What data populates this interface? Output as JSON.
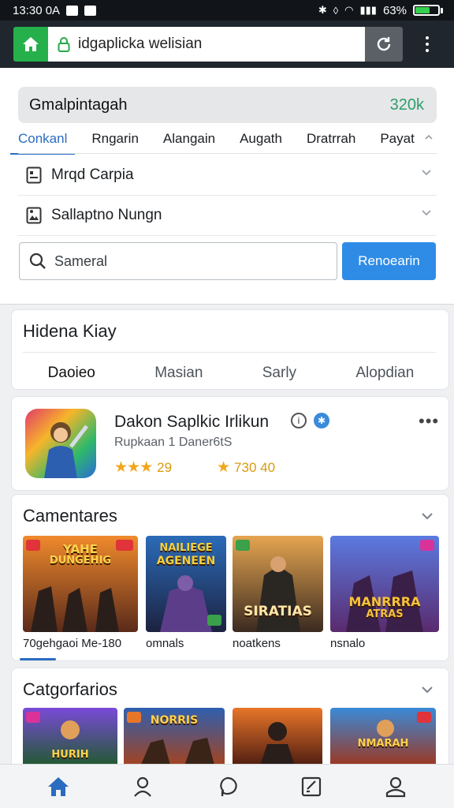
{
  "status_bar": {
    "time": "13:30 0A",
    "battery_percent": "63%",
    "battery_level": 0.63
  },
  "browser": {
    "url": "idgaplicka welisian",
    "home_icon": "home-icon",
    "lock_icon": "lock-icon",
    "reload_icon": "reload-icon",
    "menu_icon": "kebab-menu-icon"
  },
  "search_panel": {
    "title": "Gmalpintagah",
    "count": "320k",
    "tabs": [
      {
        "label": "Conkanl",
        "active": true
      },
      {
        "label": "Rngarin",
        "active": false
      },
      {
        "label": "Alangain",
        "active": false
      },
      {
        "label": "Augath",
        "active": false
      },
      {
        "label": "Dratrrah",
        "active": false
      },
      {
        "label": "Payat",
        "active": false
      }
    ],
    "filters": [
      {
        "label": "Mrqd Carpia",
        "icon": "doc-icon"
      },
      {
        "label": "Sallaptno Nungn",
        "icon": "image-icon"
      }
    ],
    "search_placeholder": "Sameral",
    "search_button": "Renoearin"
  },
  "hidden_key_card": {
    "title": "Hidena Kiay",
    "tabs": [
      {
        "label": "Daoieo",
        "active": true
      },
      {
        "label": "Masian",
        "active": false
      },
      {
        "label": "Sarly",
        "active": false
      },
      {
        "label": "Alopdian",
        "active": false
      }
    ]
  },
  "app_card": {
    "name": "Dakon Saplkic Irlikun",
    "subtitle": "Rupkaan 1 Daner6tS",
    "rating_a": "29",
    "rating_a_stars": 3,
    "rating_b": "730 40"
  },
  "comments_section": {
    "title": "Camentares",
    "thumbs": [
      {
        "art_title": "YAHE",
        "art_sub": "DUNGEHIG",
        "caption": "70gehgaoi Me-180",
        "colors": [
          "#f08a2c",
          "#5a2a1a"
        ]
      },
      {
        "art_title": "NAILIEGE",
        "art_sub": "AGENEEN",
        "caption": "omnals",
        "colors": [
          "#2b6bb8",
          "#1c2240"
        ]
      },
      {
        "art_title": "SIRATIAS",
        "art_sub": "",
        "caption": "noatkens",
        "colors": [
          "#e5a550",
          "#3a2a20"
        ]
      },
      {
        "art_title": "MANRRRA",
        "art_sub": "ATRAS",
        "caption": "nsnalo",
        "colors": [
          "#5b7ae0",
          "#5a2a6e"
        ]
      }
    ]
  },
  "categories_section": {
    "title": "Catgorfarios",
    "thumbs": [
      {
        "art_title": "HURIH",
        "colors": [
          "#7a4ad8",
          "#1e5a2a"
        ]
      },
      {
        "art_title": "NORRIS",
        "colors": [
          "#2f5fb0",
          "#a8421a"
        ]
      },
      {
        "art_title": "",
        "colors": [
          "#e8762a",
          "#4a1a10"
        ]
      },
      {
        "art_title": "NMARAH",
        "colors": [
          "#3a8ad8",
          "#a0341a"
        ]
      }
    ]
  },
  "bottom_nav": [
    {
      "icon": "home-icon",
      "active": true
    },
    {
      "icon": "profile-icon",
      "active": false
    },
    {
      "icon": "chat-bubble-icon",
      "active": false
    },
    {
      "icon": "edit-note-icon",
      "active": false
    },
    {
      "icon": "account-icon",
      "active": false
    }
  ],
  "colors": {
    "accent": "#2a6cc0",
    "primary_button": "#2f8ce6",
    "home_green": "#25b04b",
    "count_green": "#2e9e6c",
    "star": "#f1a61b"
  }
}
